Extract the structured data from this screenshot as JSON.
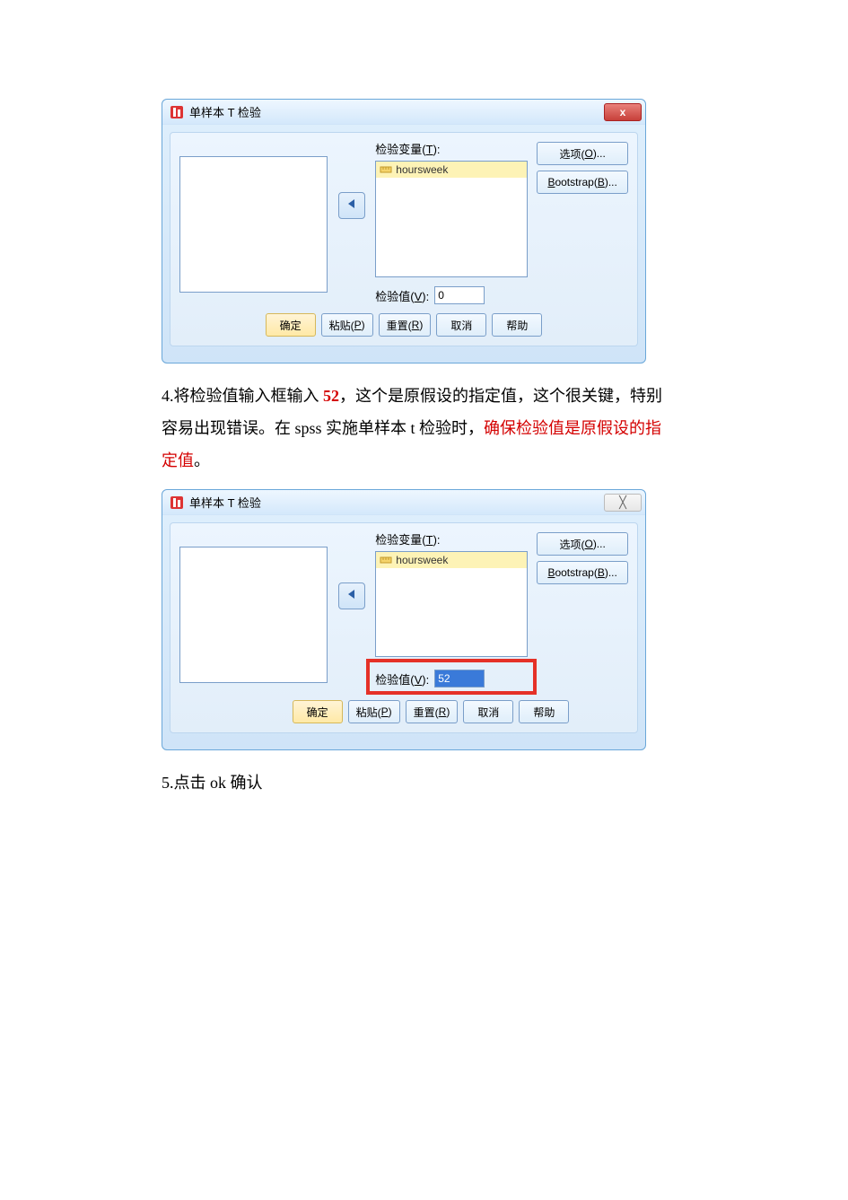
{
  "dialog1": {
    "title": "单样本 T 检验",
    "close_glyph": "x",
    "labels": {
      "test_vars": "检验变量(",
      "test_vars_u": "T",
      "test_vars_after": "):",
      "test_value": "检验值(",
      "test_value_u": "V",
      "test_value_after": "):",
      "options": "选项(",
      "options_u": "O",
      "options_after": ")...",
      "bootstrap": "ootstrap(",
      "bootstrap_pre": "B",
      "bootstrap_u": "B",
      "bootstrap_after": ")..."
    },
    "target_item": "hoursweek",
    "test_value": "0",
    "buttons": {
      "ok": "确定",
      "paste": "粘贴(",
      "paste_u": "P",
      "paste_after": ")",
      "reset": "重置(",
      "reset_u": "R",
      "reset_after": ")",
      "cancel": "取消",
      "help": "帮助"
    }
  },
  "para1": {
    "t1": "4.将检验值输入框输入 ",
    "t2_red_bold": "52",
    "t3": "，这个是原假设的指定值，这个很关键，特别容易出现错误。在 spss 实施单样本 t 检验时，",
    "t4_red": "确保检验值是原假设的指定值",
    "t5": "。"
  },
  "dialog2": {
    "title": "单样本 T 检验",
    "close_glyph": "╳",
    "labels": {
      "test_vars": "检验变量(",
      "test_vars_u": "T",
      "test_vars_after": "):",
      "test_value": "检验值(",
      "test_value_u": "V",
      "test_value_after": "):",
      "options": "选项(",
      "options_u": "O",
      "options_after": ")...",
      "bootstrap_pre": "B",
      "bootstrap": "ootstrap(",
      "bootstrap_u": "B",
      "bootstrap_after": ")..."
    },
    "target_item": "hoursweek",
    "test_value": "52",
    "buttons": {
      "ok": "确定",
      "paste": "粘贴(",
      "paste_u": "P",
      "paste_after": ")",
      "reset": "重置(",
      "reset_u": "R",
      "reset_after": ")",
      "cancel": "取消",
      "help": "帮助"
    }
  },
  "para2": {
    "text": "5.点击 ok 确认"
  }
}
